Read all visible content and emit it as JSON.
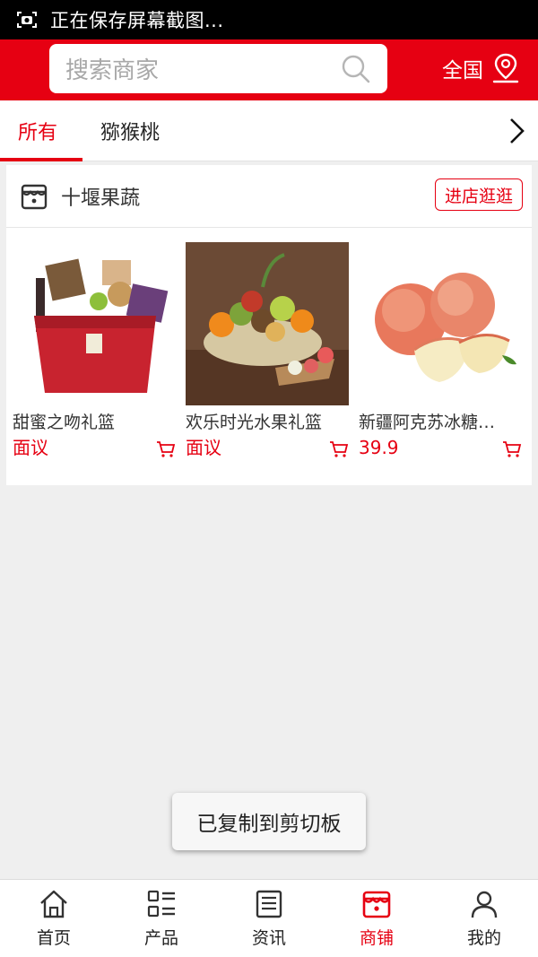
{
  "status_bar": {
    "text": "正在保存屏幕截图..."
  },
  "header": {
    "search_placeholder": "搜索商家",
    "region_label": "全国"
  },
  "tabs": [
    {
      "label": "所有",
      "active": true
    },
    {
      "label": "猕猴桃",
      "active": false
    }
  ],
  "shop": {
    "name": "十堰果蔬",
    "enter_label": "进店逛逛",
    "products": [
      {
        "name": "甜蜜之吻礼篮",
        "price": "面议",
        "image": "gift-basket-image"
      },
      {
        "name": "欢乐时光水果礼篮",
        "price": "面议",
        "image": "fruit-basket-image"
      },
      {
        "name": "新疆阿克苏冰糖…",
        "price": "39.9",
        "image": "apples-image"
      }
    ]
  },
  "toast": {
    "text": "已复制到剪切板"
  },
  "bottom_nav": [
    {
      "label": "首页",
      "icon": "home-icon",
      "active": false
    },
    {
      "label": "产品",
      "icon": "grid-list-icon",
      "active": false
    },
    {
      "label": "资讯",
      "icon": "news-icon",
      "active": false
    },
    {
      "label": "商铺",
      "icon": "shop-icon",
      "active": true
    },
    {
      "label": "我的",
      "icon": "user-icon",
      "active": false
    }
  ],
  "colors": {
    "accent": "#e60012",
    "background": "#efefef"
  }
}
